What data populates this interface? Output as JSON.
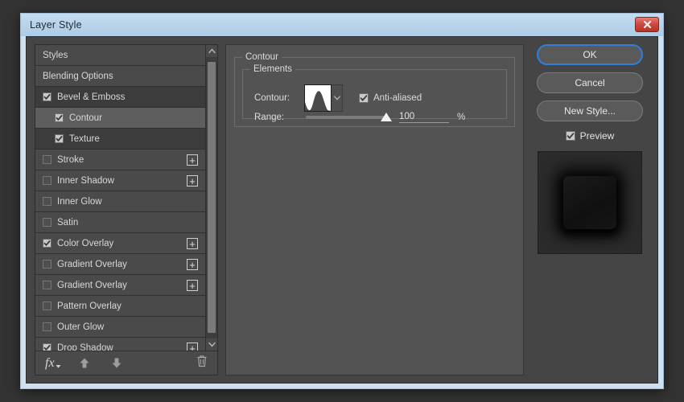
{
  "window": {
    "title": "Layer Style",
    "close_icon": "close-x-icon",
    "accent": "#b7d2ea",
    "close_color": "#cf4b40"
  },
  "styles_panel": {
    "items": [
      {
        "label": "Styles",
        "checkbox": "none",
        "indent": false,
        "state": "header",
        "plus": false
      },
      {
        "label": "Blending Options",
        "checkbox": "none",
        "indent": false,
        "state": "normal",
        "plus": false
      },
      {
        "label": "Bevel & Emboss",
        "checkbox": "checked",
        "indent": false,
        "state": "dim",
        "plus": false
      },
      {
        "label": "Contour",
        "checkbox": "checked",
        "indent": true,
        "state": "selected",
        "plus": false
      },
      {
        "label": "Texture",
        "checkbox": "checked",
        "indent": true,
        "state": "dim",
        "plus": false
      },
      {
        "label": "Stroke",
        "checkbox": "unchecked",
        "indent": false,
        "state": "normal",
        "plus": true
      },
      {
        "label": "Inner Shadow",
        "checkbox": "unchecked",
        "indent": false,
        "state": "normal",
        "plus": true
      },
      {
        "label": "Inner Glow",
        "checkbox": "unchecked",
        "indent": false,
        "state": "normal",
        "plus": false
      },
      {
        "label": "Satin",
        "checkbox": "unchecked",
        "indent": false,
        "state": "normal",
        "plus": false
      },
      {
        "label": "Color Overlay",
        "checkbox": "checked",
        "indent": false,
        "state": "normal",
        "plus": true
      },
      {
        "label": "Gradient Overlay",
        "checkbox": "unchecked",
        "indent": false,
        "state": "normal",
        "plus": true
      },
      {
        "label": "Gradient Overlay",
        "checkbox": "unchecked",
        "indent": false,
        "state": "normal",
        "plus": true
      },
      {
        "label": "Pattern Overlay",
        "checkbox": "unchecked",
        "indent": false,
        "state": "normal",
        "plus": false
      },
      {
        "label": "Outer Glow",
        "checkbox": "unchecked",
        "indent": false,
        "state": "normal",
        "plus": false
      },
      {
        "label": "Drop Shadow",
        "checkbox": "checked",
        "indent": false,
        "state": "normal",
        "plus": true
      }
    ],
    "plus_label": "+",
    "scrollbar": {
      "up_icon": "chevron-up-icon",
      "down_icon": "chevron-down-icon"
    },
    "toolbar": {
      "fx_label": "fx",
      "fx_icon": "fx-menu-icon",
      "move_up_icon": "arrow-up-icon",
      "move_down_icon": "arrow-down-icon",
      "delete_icon": "trash-icon"
    }
  },
  "contour_panel": {
    "group_title": "Contour",
    "elements_title": "Elements",
    "contour_label": "Contour:",
    "contour_swatch_icon": "contour-curve-thumbnail",
    "contour_dropdown_icon": "chevron-down-icon",
    "antialiased_label": "Anti-aliased",
    "antialiased_checked": true,
    "range_label": "Range:",
    "range_value": "100",
    "range_unit": "%",
    "range_percent": 100
  },
  "actions": {
    "ok_label": "OK",
    "cancel_label": "Cancel",
    "new_style_label": "New Style...",
    "preview_label": "Preview",
    "preview_checked": true,
    "focus_color": "#2f7fd8"
  }
}
